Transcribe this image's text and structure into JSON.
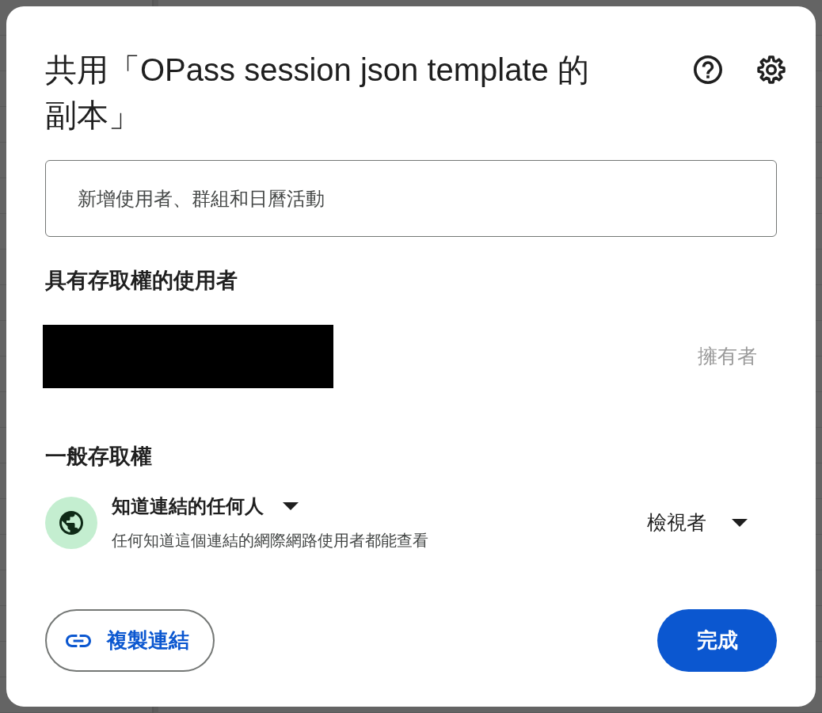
{
  "dialog": {
    "title": "共用「OPass session json template 的副本」"
  },
  "add_people_field": {
    "placeholder": "新增使用者、群組和日曆活動"
  },
  "people_with_access": {
    "heading": "具有存取權的使用者",
    "people": [
      {
        "redacted": true,
        "role": "擁有者"
      }
    ]
  },
  "general_access": {
    "heading": "一般存取權",
    "audience": "知道連結的任何人",
    "description": "任何知道這個連結的網際網路使用者都能查看",
    "role": "檢視者"
  },
  "buttons": [
    {
      "kind": "outline",
      "label": "複製連結"
    },
    {
      "kind": "primary",
      "label": "完成"
    }
  ]
}
